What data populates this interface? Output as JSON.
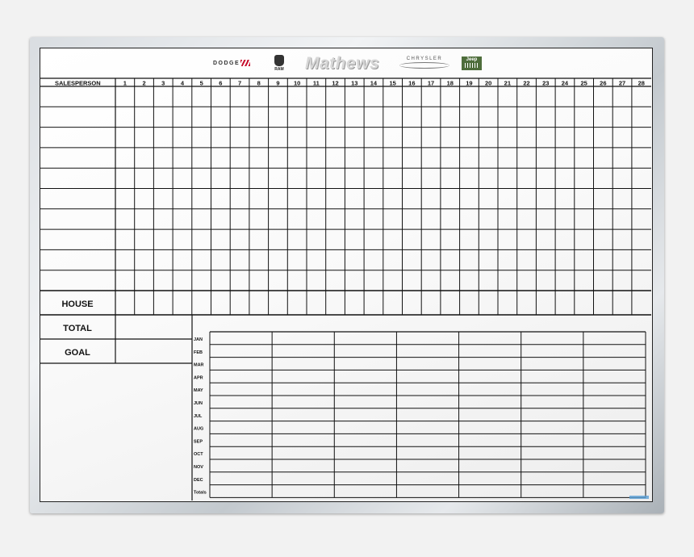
{
  "logos": {
    "dodge": "DODGE",
    "ram": "RAM",
    "mathews": "Mathews",
    "chrysler": "CHRYSLER",
    "jeep": "Jeep"
  },
  "grid": {
    "salesperson_header": "SALESPERSON",
    "days": [
      "1",
      "2",
      "3",
      "4",
      "5",
      "6",
      "7",
      "8",
      "9",
      "10",
      "11",
      "12",
      "13",
      "14",
      "15",
      "16",
      "17",
      "18",
      "19",
      "20",
      "21",
      "22",
      "23",
      "24",
      "25",
      "26",
      "27",
      "28"
    ],
    "salesperson_rows": 10,
    "house_label": "HOUSE",
    "total_label": "TOTAL",
    "goal_label": "GOAL"
  },
  "monthly": {
    "rows": [
      "JAN",
      "FEB",
      "MAR",
      "APR",
      "MAY",
      "JUN",
      "JUL",
      "AUG",
      "SEP",
      "OCT",
      "NOV",
      "DEC",
      "Totals"
    ],
    "columns": 7
  },
  "colors": {
    "ink": "#111111",
    "dodge_stripe": "#c8102e",
    "jeep_green": "#4e6d3b",
    "frame": "#c3c9ce"
  }
}
